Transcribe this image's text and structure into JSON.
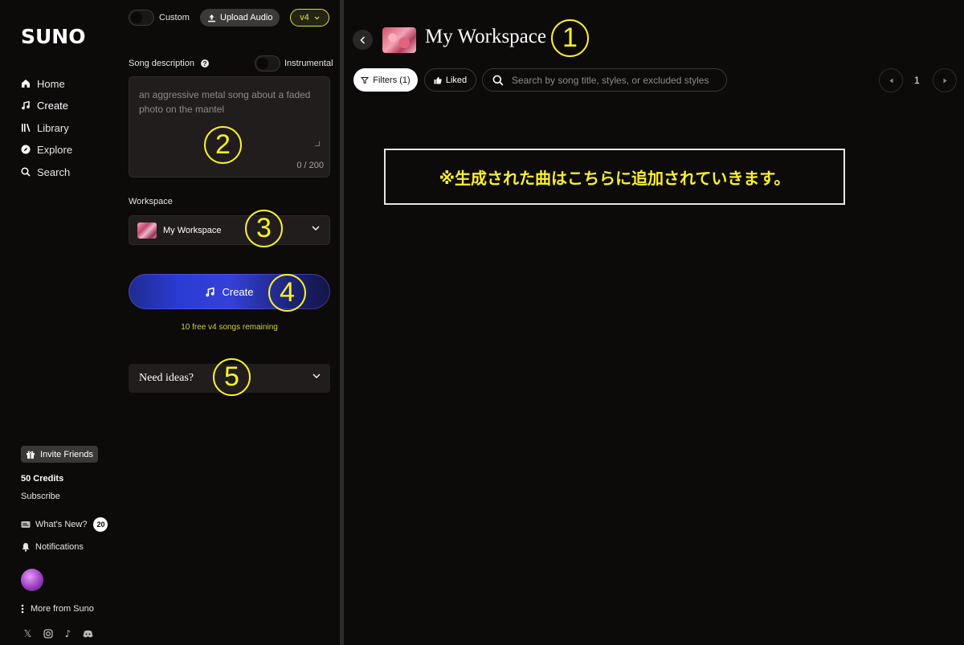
{
  "logo": "SUNO",
  "nav": {
    "home": "Home",
    "create": "Create",
    "library": "Library",
    "explore": "Explore",
    "search": "Search"
  },
  "sidebar_bottom": {
    "invite": "Invite Friends",
    "credits": "50 Credits",
    "subscribe": "Subscribe",
    "whats_new": "What's New?",
    "whats_new_count": "20",
    "notifications": "Notifications",
    "more": "More from Suno"
  },
  "create_panel": {
    "custom_label": "Custom",
    "upload_label": "Upload Audio",
    "version": "v4",
    "song_description_label": "Song description",
    "help_icon": "?",
    "instrumental_label": "Instrumental",
    "description_placeholder": "an aggressive metal song about a faded photo on the mantel",
    "char_count": "0 / 200",
    "workspace_label": "Workspace",
    "workspace_value": "My Workspace",
    "create_button": "Create",
    "remaining": "10 free v4 songs remaining",
    "need_ideas": "Need ideas?"
  },
  "workspace": {
    "title": "My Workspace",
    "filters": "Filters (1)",
    "liked": "Liked",
    "search_placeholder": "Search by song title, styles, or excluded styles",
    "page": "1"
  },
  "annotations": {
    "n1": "1",
    "n2": "2",
    "n3": "3",
    "n4": "4",
    "n5": "5",
    "note": "※生成された曲はこちらに追加されていきます。"
  },
  "colors": {
    "accent_yellow": "#fcf02c",
    "version_green": "#d8e54d",
    "create_blue": "#2a3cd3"
  }
}
